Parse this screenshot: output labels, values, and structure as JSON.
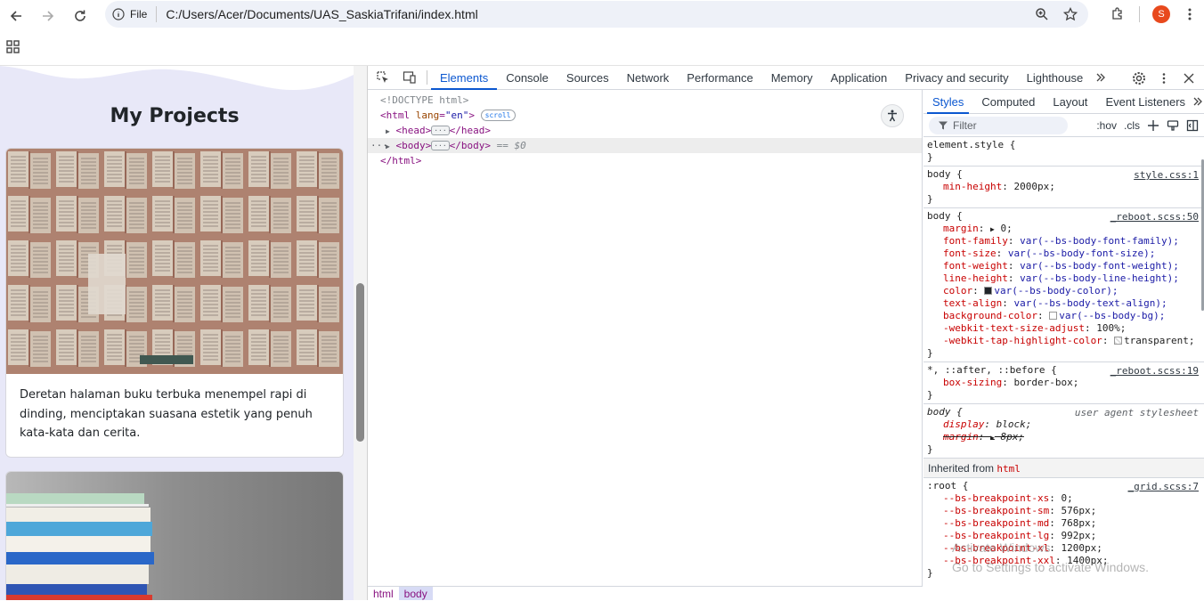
{
  "browser": {
    "url_scheme_label": "File",
    "url": "C:/Users/Acer/Documents/UAS_SaskiaTrifani/index.html",
    "avatar_letter": "S",
    "avatar_color": "#e8491d"
  },
  "page": {
    "title": "My Projects",
    "cards": [
      {
        "text": "Deretan halaman buku terbuka menempel rapi di dinding, menciptakan suasana estetik yang penuh kata-kata dan cerita."
      }
    ]
  },
  "devtools": {
    "tabs": [
      "Elements",
      "Console",
      "Sources",
      "Network",
      "Performance",
      "Memory",
      "Application",
      "Privacy and security",
      "Lighthouse"
    ],
    "active_tab": "Elements",
    "dom": {
      "doctype": "<!DOCTYPE html>",
      "html_open": "<html",
      "html_attr": "lang",
      "html_attr_val": "\"en\"",
      "html_gt": ">",
      "scroll_badge": "scroll",
      "head_open": "<head>",
      "head_close": "</head>",
      "body_open": "<body>",
      "body_close": "</body>",
      "body_suffix": "== $0",
      "html_close": "</html>",
      "ellipsis": "···",
      "more": "···"
    },
    "breadcrumbs": [
      "html",
      "body"
    ],
    "styles": {
      "tabs": [
        "Styles",
        "Computed",
        "Layout",
        "Event Listeners"
      ],
      "filter_placeholder": "Filter",
      "hov": ":hov",
      "cls": ".cls",
      "rules": [
        {
          "selector": "element.style {",
          "source": "",
          "props": [],
          "close": "}"
        },
        {
          "selector": "body {",
          "source": "style.css:1",
          "props": [
            {
              "n": "min-height",
              "v": "2000px;"
            }
          ],
          "close": "}"
        },
        {
          "selector": "body {",
          "source": "_reboot.scss:50",
          "close": "}"
        },
        {
          "selector": "*, ::after, ::before {",
          "source": "_reboot.scss:19",
          "props": [
            {
              "n": "box-sizing",
              "v": "border-box;"
            }
          ],
          "close": "}"
        },
        {
          "selector": "body {",
          "source": "user agent stylesheet",
          "close": "}"
        }
      ],
      "reboot_body": {
        "margin_n": "margin",
        "margin_v": "0;",
        "ff_n": "font-family",
        "ff_v": "var(--bs-body-font-family);",
        "fs_n": "font-size",
        "fs_v": "var(--bs-body-font-size);",
        "fw_n": "font-weight",
        "fw_v": "var(--bs-body-font-weight);",
        "lh_n": "line-height",
        "lh_v": "var(--bs-body-line-height);",
        "col_n": "color",
        "col_v": "var(--bs-body-color);",
        "ta_n": "text-align",
        "ta_v": "var(--bs-body-text-align);",
        "bg_n": "background-color",
        "bg_v": "var(--bs-body-bg);",
        "wk_n": "-webkit-text-size-adjust",
        "wk_v": "100%;",
        "th_n": "-webkit-tap-highlight-color",
        "th_v": "transparent;"
      },
      "ua_body": {
        "d_n": "display",
        "d_v": "block;",
        "m_n": "margin",
        "m_v": "8px;"
      },
      "inherited_label": "Inherited from",
      "inherited_tag": "html",
      "root_rule": {
        "selector": ":root {",
        "source": "_grid.scss:7",
        "props": [
          {
            "n": "--bs-breakpoint-xs",
            "v": "0;"
          },
          {
            "n": "--bs-breakpoint-sm",
            "v": "576px;"
          },
          {
            "n": "--bs-breakpoint-md",
            "v": "768px;"
          },
          {
            "n": "--bs-breakpoint-lg",
            "v": "992px;"
          },
          {
            "n": "--bs-breakpoint-xl",
            "v": "1200px;"
          },
          {
            "n": "--bs-breakpoint-xxl",
            "v": "1400px;"
          }
        ],
        "close": "}"
      }
    }
  },
  "watermark": {
    "line1": "Activate Windows",
    "line2": "Go to Settings to activate Windows."
  }
}
